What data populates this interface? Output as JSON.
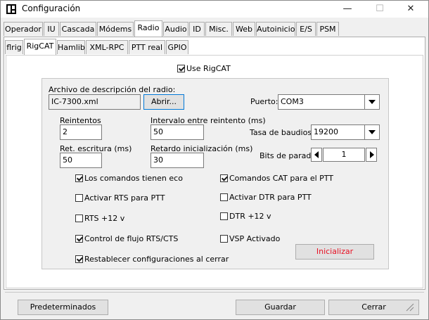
{
  "window": {
    "title": "Configuración",
    "minimize": "—",
    "maximize": "☐",
    "close": "✕"
  },
  "tabs_main": [
    {
      "label": "Operador"
    },
    {
      "label": "IU"
    },
    {
      "label": "Cascada"
    },
    {
      "label": "Módems"
    },
    {
      "label": "Radio",
      "active": true
    },
    {
      "label": "Audio"
    },
    {
      "label": "ID"
    },
    {
      "label": "Misc."
    },
    {
      "label": "Web"
    },
    {
      "label": "Autoinicio"
    },
    {
      "label": "E/S"
    },
    {
      "label": "PSM"
    }
  ],
  "tabs_sub": [
    {
      "label": "flrig"
    },
    {
      "label": "RigCAT",
      "active": true
    },
    {
      "label": "Hamlib"
    },
    {
      "label": "XML-RPC"
    },
    {
      "label": "PTT real"
    },
    {
      "label": "GPIO"
    }
  ],
  "rigcat": {
    "use_rigcat": "Use RigCAT",
    "file_label": "Archivo de descripción del radio:",
    "file_value": "IC-7300.xml",
    "open_button": "Abrir...",
    "port_label": "Puerto:",
    "port_value": "COM3",
    "retries_label": "Reintentos",
    "retries_value": "2",
    "retry_interval_label": "Intervalo entre reintento (ms)",
    "retry_interval_value": "50",
    "baud_label": "Tasa de baudios:",
    "baud_value": "19200",
    "write_delay_label": "Ret. escritura (ms)",
    "write_delay_value": "50",
    "init_delay_label": "Retardo inicialización (ms)",
    "init_delay_value": "30",
    "stop_bits_label": "Bits de parada",
    "stop_bits_value": "1",
    "checkboxes": {
      "echo": "Los comandos tienen eco",
      "cat_ptt": "Comandos CAT para el PTT",
      "rts_ptt": "Activar RTS para PTT",
      "dtr_ptt": "Activar DTR para PTT",
      "rts12": "RTS +12 v",
      "dtr12": "DTR +12 v",
      "flow": "Control de flujo RTS/CTS",
      "vsp": "VSP Activado",
      "restore": "Restablecer configuraciones al cerrar"
    },
    "init_button": "Inicializar",
    "init_button_color": "#e81123"
  },
  "footer": {
    "defaults": "Predeterminados",
    "save": "Guardar",
    "close": "Cerrar"
  }
}
